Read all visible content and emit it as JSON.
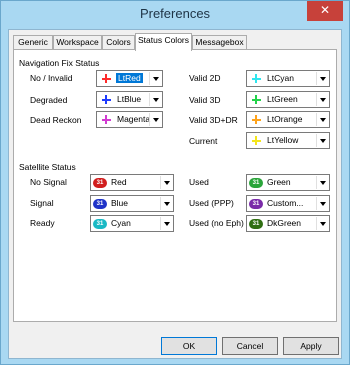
{
  "window": {
    "title": "Preferences",
    "close_symbol": "✕"
  },
  "tabs": [
    {
      "label": "Generic"
    },
    {
      "label": "Workspace"
    },
    {
      "label": "Colors"
    },
    {
      "label": "Status Colors"
    },
    {
      "label": "Messagebox"
    }
  ],
  "active_tab": "Status Colors",
  "nav": {
    "title": "Navigation Fix Status",
    "rows": [
      {
        "label": "No / Invalid",
        "value": "LtRed",
        "color": "#ff2b2b",
        "icon": "cross-icon",
        "selected": true
      },
      {
        "label": "Degraded",
        "value": "LtBlue",
        "color": "#1f3bff",
        "icon": "cross-icon"
      },
      {
        "label": "Dead Reckon",
        "value": "Magenta",
        "color": "#d23bd2",
        "icon": "cross-icon"
      },
      {
        "label": "Valid 2D",
        "value": "LtCyan",
        "color": "#2fe6ee",
        "icon": "cross-icon"
      },
      {
        "label": "Valid 3D",
        "value": "LtGreen",
        "color": "#22d34a",
        "icon": "cross-icon"
      },
      {
        "label": "Valid 3D+DR",
        "value": "LtOrange",
        "color": "#ffa31a",
        "icon": "cross-icon"
      },
      {
        "label": "Current",
        "value": "LtYellow",
        "color": "#f4e51a",
        "icon": "cross-icon"
      }
    ]
  },
  "sat": {
    "title": "Satellite Status",
    "badge": "31",
    "rows": [
      {
        "label": "No Signal",
        "value": "Red",
        "color": "#d11e1e",
        "icon": "satellite-icon"
      },
      {
        "label": "Signal",
        "value": "Blue",
        "color": "#1f33c8",
        "icon": "satellite-icon"
      },
      {
        "label": "Ready",
        "value": "Cyan",
        "color": "#1ab9c4",
        "icon": "satellite-icon"
      },
      {
        "label": "Used",
        "value": "Green",
        "color": "#2aa53a",
        "icon": "satellite-icon"
      },
      {
        "label": "Used (PPP)",
        "value": "Custom...",
        "color": "#7a2aa8",
        "icon": "satellite-icon"
      },
      {
        "label": "Used (no Eph)",
        "value": "DkGreen",
        "color": "#2f6e12",
        "icon": "satellite-icon"
      }
    ]
  },
  "buttons": {
    "ok": "OK",
    "cancel": "Cancel",
    "apply": "Apply"
  }
}
